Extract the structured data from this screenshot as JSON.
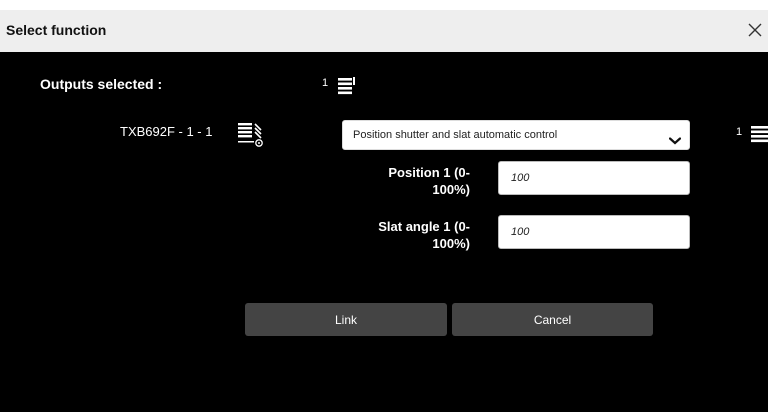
{
  "dialog": {
    "title": "Select function"
  },
  "outputs": {
    "label": "Outputs selected :",
    "count": "1"
  },
  "device": {
    "name": "TXB692F - 1 - 1",
    "function_selected": "Position shutter and slat automatic control",
    "right_count": "1"
  },
  "fields": {
    "position": {
      "label_line1": "Position 1 (0-",
      "label_line2": "100%)",
      "value": "100"
    },
    "slat": {
      "label_line1": "Slat angle 1 (0-",
      "label_line2": "100%)",
      "value": "100"
    }
  },
  "buttons": {
    "link": "Link",
    "cancel": "Cancel"
  },
  "colors": {
    "dialog_background": "#000000",
    "titlebar_background": "#eeeeee",
    "button_background": "#444444"
  },
  "icons": [
    "close-icon",
    "shutter-stack-icon",
    "shutter-device-icon",
    "chevron-down-icon"
  ]
}
